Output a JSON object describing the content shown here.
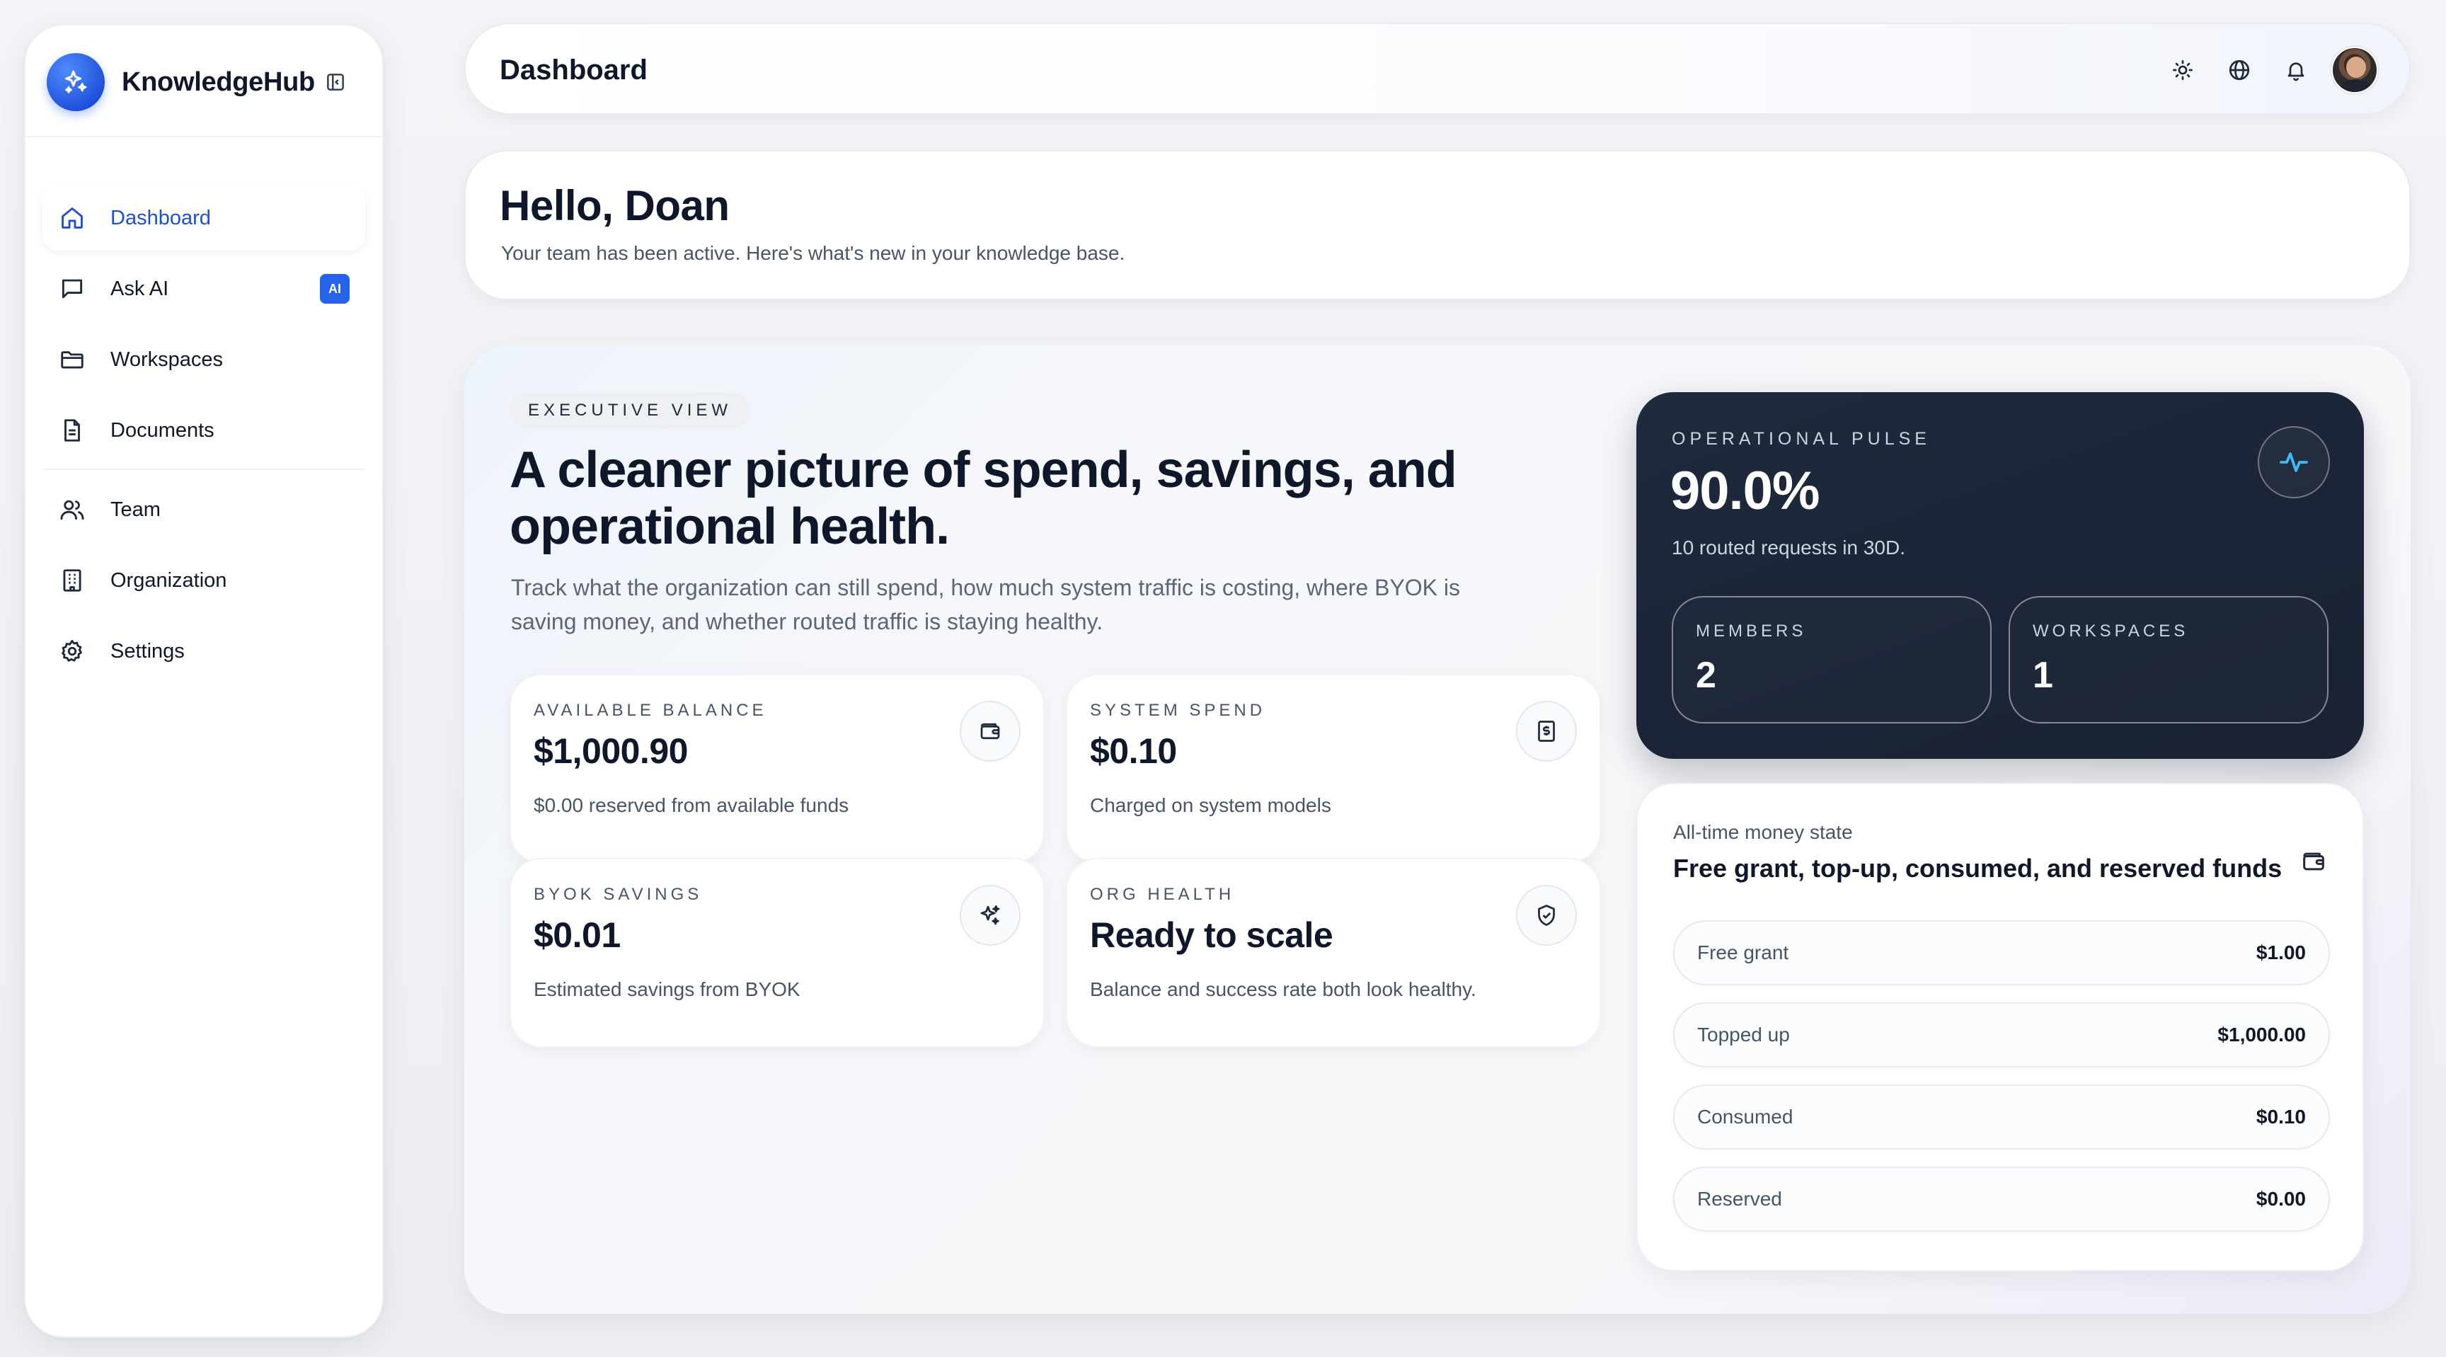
{
  "brand": {
    "name": "KnowledgeHub"
  },
  "sidebar": {
    "items": [
      {
        "label": "Dashboard",
        "icon": "home-icon",
        "active": true
      },
      {
        "label": "Ask AI",
        "icon": "chat-icon",
        "badge": "AI"
      },
      {
        "label": "Workspaces",
        "icon": "folder-icon"
      },
      {
        "label": "Documents",
        "icon": "document-icon"
      },
      {
        "label": "Team",
        "icon": "users-icon"
      },
      {
        "label": "Organization",
        "icon": "building-icon"
      },
      {
        "label": "Settings",
        "icon": "gear-icon"
      }
    ]
  },
  "header": {
    "title": "Dashboard",
    "icons": [
      "sun-icon",
      "globe-icon",
      "bell-icon",
      "avatar"
    ]
  },
  "greeting": {
    "title": "Hello, Doan",
    "subtitle": "Your team has been active. Here's what's new in your knowledge base."
  },
  "executive": {
    "eyebrow": "EXECUTIVE VIEW",
    "title": "A cleaner picture of spend, savings, and operational health.",
    "description": "Track what the organization can still spend, how much system traffic is costing, where BYOK is saving money, and whether routed traffic is staying healthy.",
    "stats": [
      {
        "label": "AVAILABLE BALANCE",
        "value": "$1,000.90",
        "note": "$0.00 reserved from available funds",
        "icon": "wallet-icon"
      },
      {
        "label": "SYSTEM SPEND",
        "value": "$0.10",
        "note": "Charged on system models",
        "icon": "receipt-dollar-icon"
      },
      {
        "label": "BYOK SAVINGS",
        "value": "$0.01",
        "note": "Estimated savings from BYOK",
        "icon": "sparkles-icon"
      },
      {
        "label": "ORG HEALTH",
        "value": "Ready to scale",
        "note": "Balance and success rate both look healthy.",
        "icon": "shield-check-icon"
      }
    ]
  },
  "pulse": {
    "label": "OPERATIONAL PULSE",
    "value": "90.0%",
    "note": "10 routed requests in 30D.",
    "members": {
      "label": "MEMBERS",
      "value": "2"
    },
    "workspaces": {
      "label": "WORKSPACES",
      "value": "1"
    }
  },
  "money": {
    "eyebrow": "All-time money state",
    "title": "Free grant, top-up, consumed, and reserved funds",
    "rows": [
      {
        "label": "Free grant",
        "value": "$1.00"
      },
      {
        "label": "Topped up",
        "value": "$1,000.00"
      },
      {
        "label": "Consumed",
        "value": "$0.10"
      },
      {
        "label": "Reserved",
        "value": "$0.00"
      }
    ]
  },
  "colors": {
    "accent": "#2563eb",
    "dark_card": "#1e293b",
    "pulse_icon": "#38bdf8"
  }
}
